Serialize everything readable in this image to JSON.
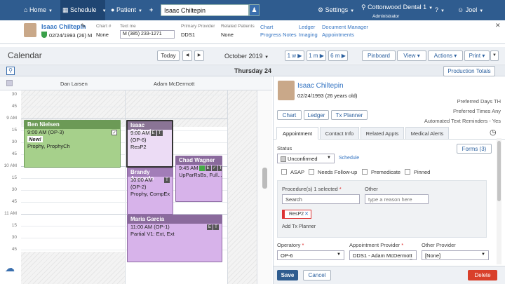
{
  "nav": {
    "home": "Home",
    "schedule": "Schedule",
    "patient": "Patient",
    "plus": "+",
    "search_value": "Isaac Chiltepin",
    "settings": "Settings",
    "office": "Cottonwood Dental 1",
    "office_role": "Administrator",
    "help": "?",
    "user": "Joel"
  },
  "patient_bar": {
    "name": "Isaac Chiltepin",
    "dob": "02/24/1993 (26) M",
    "chart_label": "Chart #",
    "chart_value": "None",
    "text_label": "Text me",
    "text_value": "M (385) 233-1271",
    "provider_label": "Primary Provider",
    "provider_value": "DDS1",
    "related_label": "Related Patients",
    "related_value": "None",
    "links": [
      "Chart",
      "Progress Notes",
      "Ledger",
      "Imaging",
      "Document Manager",
      "Appointments"
    ]
  },
  "calendar": {
    "title": "Calendar",
    "today": "Today",
    "prev": "◀",
    "next": "▶",
    "month": "October 2019",
    "views": [
      "1 w",
      "1 m",
      "6 m"
    ],
    "pinboard": "Pinboard",
    "view_btn": "View",
    "actions_btn": "Actions",
    "print_btn": "Print",
    "day_title": "Thursday 24",
    "production_totals": "Production Totals",
    "providers": [
      "Dan Larsen",
      "Adam McDermott"
    ],
    "times": [
      "30",
      "45",
      "9 AM",
      "15",
      "30",
      "45",
      "10 AM",
      "15",
      "30",
      "45",
      "11 AM",
      "15",
      "30",
      "45"
    ]
  },
  "appointments": [
    {
      "name": "Ben Nielsen",
      "time": "9:00 AM",
      "op": "(OP-3)",
      "tag": "New!",
      "proc": "Prophy, ProphyCh"
    },
    {
      "name": "Isaac Chiltepin",
      "time": "9:00 AM",
      "op": "(OP-6)",
      "proc": "ResP2"
    },
    {
      "name": "Chad Wagner",
      "time": "9:45 AM",
      "op": "",
      "proc": "UpParRsBs, Full..."
    },
    {
      "name": "Brandy Acevedo",
      "time": "10:00 AM",
      "op": "(OP-2)",
      "proc": "Prophy, CompEx"
    },
    {
      "name": "Maria Garcia",
      "time": "11:00 AM",
      "op": "(OP-1)",
      "proc": "Partial V1: Ext, Ext"
    }
  ],
  "detail": {
    "name": "Isaac Chiltepin",
    "dob": "02/24/1993 (26 years old)",
    "pref_days_label": "Preferred Days",
    "pref_days": "TH",
    "pref_times_label": "Preferred Times",
    "pref_times": "Any",
    "auto_text_label": "Automated Text Reminders -",
    "auto_text": "Yes",
    "buttons": [
      "Chart",
      "Ledger",
      "Tx Planner"
    ],
    "tabs": [
      "Appointment",
      "Contact Info",
      "Related Appts",
      "Medical Alerts"
    ],
    "status_label": "Status",
    "status_value": "Unconfirmed",
    "schedule_link": "Schedule",
    "forms_btn": "Forms (3)",
    "checks": [
      "ASAP",
      "Needs Follow-up",
      "Premedicate",
      "Pinned"
    ],
    "procedures_label": "Procedure(s) 1 selected",
    "other_label": "Other",
    "search_placeholder": "Search",
    "other_placeholder": "type a reason here",
    "proc_chip": "ResP2",
    "add_tx": "Add Tx Planner",
    "operatory_label": "Operatory",
    "operatory_value": "OP-6",
    "appt_provider_label": "Appointment Provider",
    "appt_provider_value": "DDS1 - Adam McDermott",
    "other_provider_label": "Other Provider",
    "other_provider_value": "[None]",
    "save": "Save",
    "cancel": "Cancel",
    "delete": "Delete"
  }
}
